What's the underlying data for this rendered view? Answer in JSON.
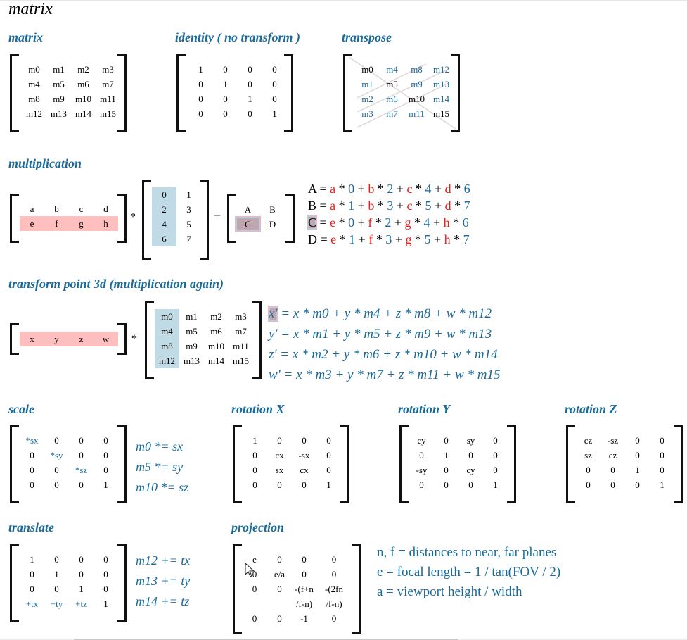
{
  "page": {
    "title": "matrix"
  },
  "sections": {
    "matrix": {
      "title": "matrix",
      "cells": [
        "m0",
        "m1",
        "m2",
        "m3",
        "m4",
        "m5",
        "m6",
        "m7",
        "m8",
        "m9",
        "m10",
        "m11",
        "m12",
        "m13",
        "m14",
        "m15"
      ]
    },
    "identity": {
      "title": "identity ( no transform )",
      "cells": [
        "1",
        "0",
        "0",
        "0",
        "0",
        "1",
        "0",
        "0",
        "0",
        "0",
        "1",
        "0",
        "0",
        "0",
        "0",
        "1"
      ]
    },
    "transpose": {
      "title": "transpose",
      "cells": [
        "m0",
        "m4",
        "m8",
        "m12",
        "m1",
        "m5",
        "m9",
        "m13",
        "m2",
        "m6",
        "m10",
        "m14",
        "m3",
        "m7",
        "m11",
        "m15"
      ]
    },
    "multiplication": {
      "title": "multiplication",
      "left": [
        "a",
        "b",
        "c",
        "d",
        "e",
        "f",
        "g",
        "h"
      ],
      "operator": "*",
      "right": [
        "0",
        "1",
        "2",
        "3",
        "4",
        "5",
        "6",
        "7"
      ],
      "equals": "=",
      "result": [
        "A",
        "B",
        "C",
        "D"
      ],
      "equations": [
        {
          "lhs": "A",
          "terms": [
            [
              "a",
              "0"
            ],
            [
              "b",
              "2"
            ],
            [
              "c",
              "4"
            ],
            [
              "d",
              "6"
            ]
          ]
        },
        {
          "lhs": "B",
          "terms": [
            [
              "a",
              "1"
            ],
            [
              "b",
              "3"
            ],
            [
              "c",
              "5"
            ],
            [
              "d",
              "7"
            ]
          ]
        },
        {
          "lhs": "C",
          "terms": [
            [
              "e",
              "0"
            ],
            [
              "f",
              "2"
            ],
            [
              "g",
              "4"
            ],
            [
              "h",
              "6"
            ]
          ]
        },
        {
          "lhs": "D",
          "terms": [
            [
              "e",
              "1"
            ],
            [
              "f",
              "3"
            ],
            [
              "g",
              "5"
            ],
            [
              "h",
              "7"
            ]
          ]
        }
      ]
    },
    "transform": {
      "title": "transform point 3d (multiplication again)",
      "vector": [
        "x",
        "y",
        "z",
        "w"
      ],
      "operator": "*",
      "cells": [
        "m0",
        "m1",
        "m2",
        "m3",
        "m4",
        "m5",
        "m6",
        "m7",
        "m8",
        "m9",
        "m10",
        "m11",
        "m12",
        "m13",
        "m14",
        "m15"
      ],
      "equations": [
        "x' = x * m0 + y * m4 + z * m8 + w * m12",
        "y' = x * m1 + y * m5 + z * m9 + w * m13",
        "z' = x * m2 + y * m6 + z * m10 + w * m14",
        "w' = x * m3 + y * m7 + z * m11 + w * m15"
      ],
      "eq_lhs": [
        "x'",
        "y'",
        "z'",
        "w'"
      ],
      "eq_rhs": [
        " = x * m0 + y * m4 + z * m8 + w * m12",
        " = x * m1 + y * m5 + z * m9 + w * m13",
        " = x * m2 + y * m6 + z * m10 + w * m14",
        " = x * m3 + y * m7 + z * m11 + w * m15"
      ]
    },
    "scale": {
      "title": "scale",
      "cells": [
        "*sx",
        "0",
        "0",
        "0",
        "0",
        "*sy",
        "0",
        "0",
        "0",
        "0",
        "*sz",
        "0",
        "0",
        "0",
        "0",
        "1"
      ],
      "notes": [
        "m0 *= sx",
        "m5 *= sy",
        "m10 *= sz"
      ]
    },
    "rotation_x": {
      "title": "rotation X",
      "cells": [
        "1",
        "0",
        "0",
        "0",
        "0",
        "cx",
        "-sx",
        "0",
        "0",
        "sx",
        "cx",
        "0",
        "0",
        "0",
        "0",
        "1"
      ]
    },
    "rotation_y": {
      "title": "rotation Y",
      "cells": [
        "cy",
        "0",
        "sy",
        "0",
        "0",
        "1",
        "0",
        "0",
        "-sy",
        "0",
        "cy",
        "0",
        "0",
        "0",
        "0",
        "1"
      ]
    },
    "rotation_z": {
      "title": "rotation Z",
      "cells": [
        "cz",
        "-sz",
        "0",
        "0",
        "sz",
        "cz",
        "0",
        "0",
        "0",
        "0",
        "1",
        "0",
        "0",
        "0",
        "0",
        "1"
      ]
    },
    "translate": {
      "title": "translate",
      "cells": [
        "1",
        "0",
        "0",
        "0",
        "0",
        "1",
        "0",
        "0",
        "0",
        "0",
        "1",
        "0",
        "+tx",
        "+ty",
        "+tz",
        "1"
      ],
      "notes": [
        "m12 += tx",
        "m13 += ty",
        "m14 += tz"
      ]
    },
    "projection": {
      "title": "projection",
      "rows": [
        [
          "e",
          "0",
          "0",
          "0"
        ],
        [
          "0",
          "e/a",
          "0",
          "0"
        ],
        [
          "0",
          "0",
          "-(f+n",
          "-(2fn"
        ],
        [
          "",
          "",
          "/f-n)",
          "/f-n)"
        ],
        [
          "0",
          "0",
          "-1",
          "0"
        ]
      ],
      "notes": [
        "n, f = distances to near, far planes",
        "e = focal length = 1 / tan(FOV / 2)",
        "a = viewport height / width"
      ]
    }
  },
  "colors": {
    "heading": "#1a6a9a",
    "red": "#e8201c",
    "row_highlight": "#ffbfbf",
    "col_highlight": "#c0dae6"
  }
}
